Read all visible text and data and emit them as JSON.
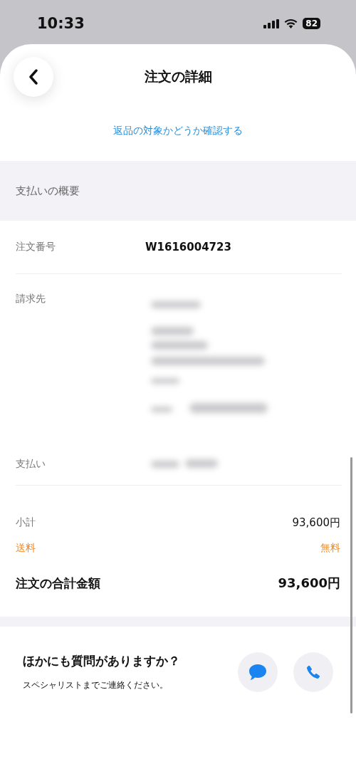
{
  "status_bar": {
    "time": "10:33",
    "battery": "82"
  },
  "header": {
    "title": "注文の詳細"
  },
  "return_link": "返品の対象かどうか確認する",
  "section_title": "支払いの概要",
  "details": [
    {
      "label": "注文番号",
      "value": "W1616004723",
      "kind": "text"
    },
    {
      "label": "請求先",
      "kind": "redacted_address"
    },
    {
      "label": "支払い",
      "kind": "redacted_short"
    }
  ],
  "totals": [
    {
      "label": "小計",
      "value": "93,600円",
      "kind": "normal"
    },
    {
      "label": "送料",
      "value": "無料",
      "kind": "highlight"
    },
    {
      "label": "注文の合計金額",
      "value": "93,600円",
      "kind": "total"
    }
  ],
  "help": {
    "title": "ほかにも質問がありますか？",
    "subtitle": "スペシャリストまでご連絡ください。"
  }
}
